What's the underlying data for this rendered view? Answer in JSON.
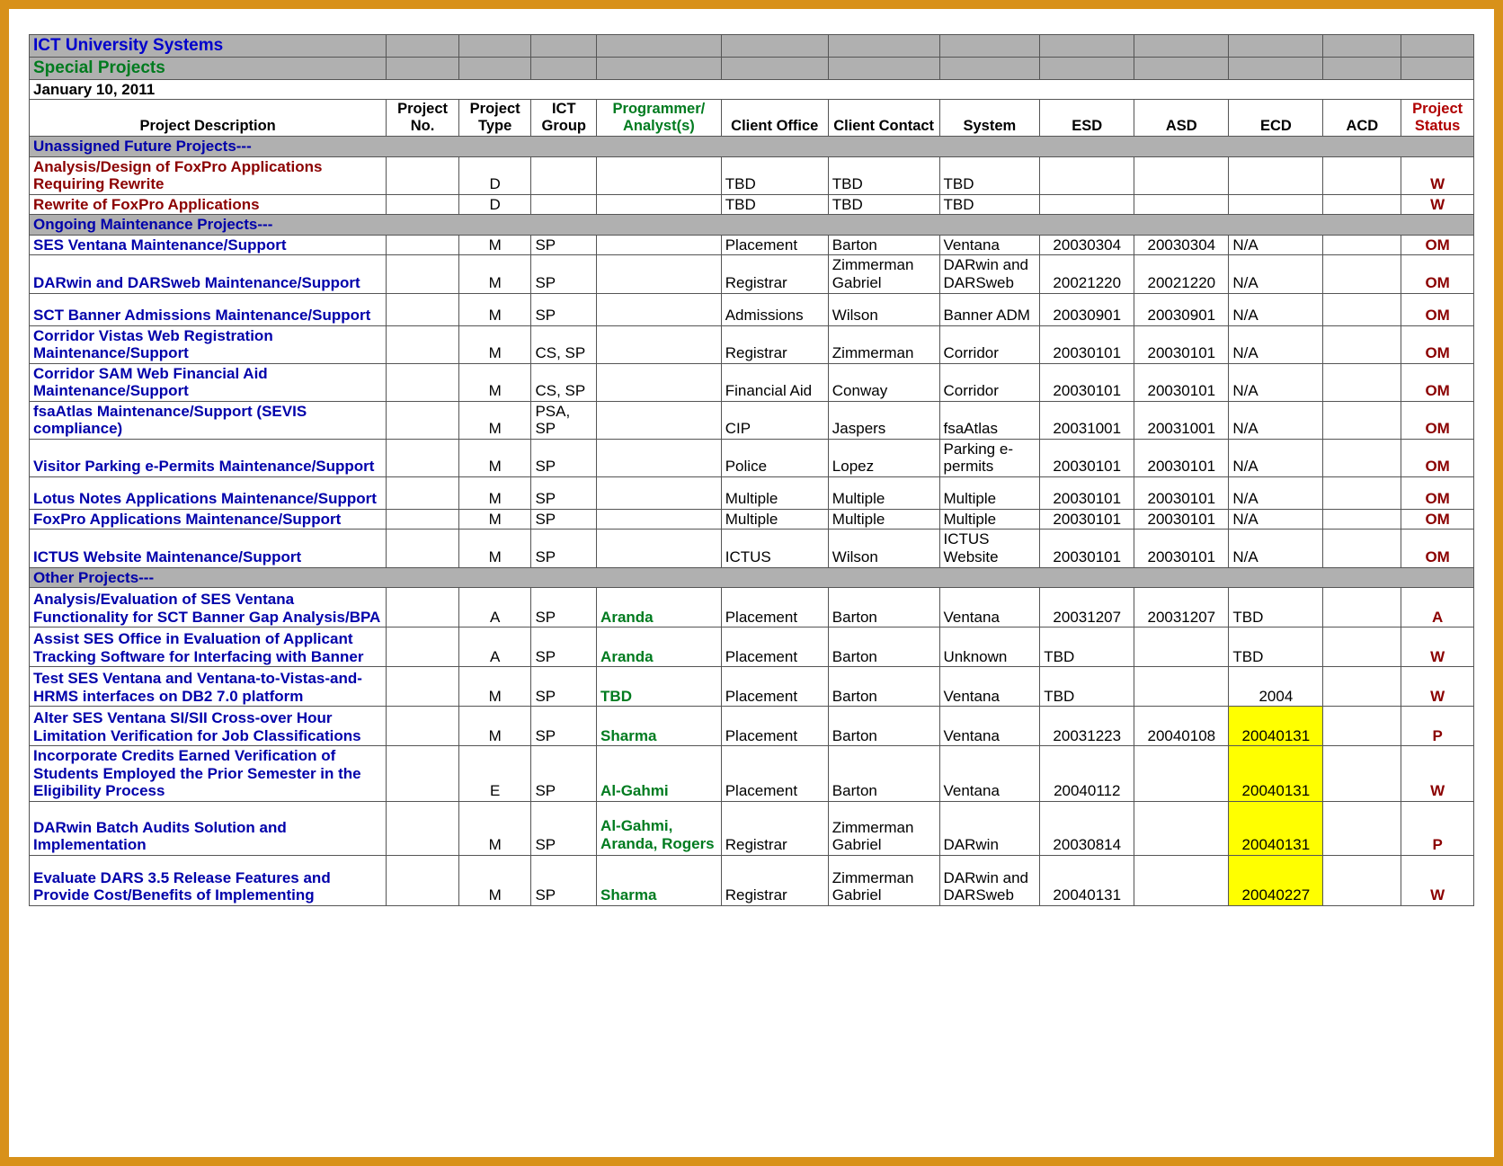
{
  "header": {
    "org": "ICT University Systems",
    "subtitle": "Special Projects",
    "date": "January 10, 2011"
  },
  "columns": {
    "desc": "Project Description",
    "no": "Project No.",
    "type": "Project Type",
    "group": "ICT Group",
    "prog": "Programmer/ Analyst(s)",
    "office": "Client Office",
    "contact": "Client Contact",
    "system": "System",
    "esd": "ESD",
    "asd": "ASD",
    "ecd": "ECD",
    "acd": "ACD",
    "status": "Project Status"
  },
  "sections": {
    "s1": "Unassigned Future Projects---",
    "s2": "Ongoing Maintenance Projects---",
    "s3": "Other Projects---"
  },
  "rows": {
    "r1": {
      "desc": "Analysis/Design of FoxPro Applications Requiring Rewrite",
      "type": "D",
      "office": "TBD",
      "contact": "TBD",
      "system": "TBD",
      "status": "W"
    },
    "r2": {
      "desc": "Rewrite of FoxPro Applications",
      "type": "D",
      "office": "TBD",
      "contact": "TBD",
      "system": "TBD",
      "status": "W"
    },
    "r3": {
      "desc": "SES Ventana Maintenance/Support",
      "type": "M",
      "group": "SP",
      "office": "Placement",
      "contact": "Barton",
      "system": "Ventana",
      "esd": "20030304",
      "asd": "20030304",
      "ecd": "N/A",
      "status": "OM"
    },
    "r4": {
      "desc": "DARwin and DARSweb Maintenance/Support",
      "type": "M",
      "group": "SP",
      "office": "Registrar",
      "contact": "Zimmerman Gabriel",
      "system": "DARwin and DARSweb",
      "esd": "20021220",
      "asd": "20021220",
      "ecd": "N/A",
      "status": "OM"
    },
    "r5": {
      "desc": "SCT Banner Admissions Maintenance/Support",
      "type": "M",
      "group": "SP",
      "office": "Admissions",
      "contact": "Wilson",
      "system": "Banner ADM",
      "esd": "20030901",
      "asd": "20030901",
      "ecd": "N/A",
      "status": "OM"
    },
    "r6": {
      "desc": "Corridor Vistas Web Registration Maintenance/Support",
      "type": "M",
      "group": "CS, SP",
      "office": "Registrar",
      "contact": "Zimmerman",
      "system": "Corridor",
      "esd": "20030101",
      "asd": "20030101",
      "ecd": "N/A",
      "status": "OM"
    },
    "r7": {
      "desc": "Corridor SAM Web Financial Aid Maintenance/Support",
      "type": "M",
      "group": "CS, SP",
      "office": "Financial Aid",
      "contact": "Conway",
      "system": "Corridor",
      "esd": "20030101",
      "asd": "20030101",
      "ecd": "N/A",
      "status": "OM"
    },
    "r8": {
      "desc": "fsaAtlas Maintenance/Support (SEVIS compliance)",
      "type": "M",
      "group": "PSA, SP",
      "office": "CIP",
      "contact": "Jaspers",
      "system": "fsaAtlas",
      "esd": "20031001",
      "asd": "20031001",
      "ecd": "N/A",
      "status": "OM"
    },
    "r9": {
      "desc": "Visitor Parking e-Permits Maintenance/Support",
      "type": "M",
      "group": "SP",
      "office": "Police",
      "contact": "Lopez",
      "system": "Parking e-permits",
      "esd": "20030101",
      "asd": "20030101",
      "ecd": "N/A",
      "status": "OM"
    },
    "r10": {
      "desc": "Lotus Notes Applications Maintenance/Support",
      "type": "M",
      "group": "SP",
      "office": "Multiple",
      "contact": "Multiple",
      "system": "Multiple",
      "esd": "20030101",
      "asd": "20030101",
      "ecd": "N/A",
      "status": "OM"
    },
    "r11": {
      "desc": "FoxPro Applications Maintenance/Support",
      "type": "M",
      "group": "SP",
      "office": "Multiple",
      "contact": "Multiple",
      "system": "Multiple",
      "esd": "20030101",
      "asd": "20030101",
      "ecd": "N/A",
      "status": "OM"
    },
    "r12": {
      "desc": "ICTUS Website Maintenance/Support",
      "type": "M",
      "group": "SP",
      "office": "ICTUS",
      "contact": "Wilson",
      "system": "ICTUS Website",
      "esd": "20030101",
      "asd": "20030101",
      "ecd": "N/A",
      "status": "OM"
    },
    "r13": {
      "desc": "Analysis/Evaluation of SES Ventana Functionality for SCT Banner Gap Analysis/BPA",
      "type": "A",
      "group": "SP",
      "prog": "Aranda",
      "office": "Placement",
      "contact": "Barton",
      "system": "Ventana",
      "esd": "20031207",
      "asd": "20031207",
      "ecd": "TBD",
      "status": "A"
    },
    "r14": {
      "desc": "Assist SES Office in Evaluation of Applicant Tracking Software for Interfacing with Banner",
      "type": "A",
      "group": "SP",
      "prog": "Aranda",
      "office": "Placement",
      "contact": "Barton",
      "system": "Unknown",
      "esd": "TBD",
      "ecd": "TBD",
      "status": "W"
    },
    "r15": {
      "desc": "Test SES Ventana and Ventana-to-Vistas-and-HRMS interfaces on DB2 7.0 platform",
      "type": "M",
      "group": "SP",
      "prog": "TBD",
      "office": "Placement",
      "contact": "Barton",
      "system": "Ventana",
      "esd": "TBD",
      "ecd": "2004",
      "status": "W"
    },
    "r16": {
      "desc": "Alter SES Ventana SI/SII Cross-over Hour Limitation Verification for Job Classifications",
      "type": "M",
      "group": "SP",
      "prog": "Sharma",
      "office": "Placement",
      "contact": "Barton",
      "system": "Ventana",
      "esd": "20031223",
      "asd": "20040108",
      "ecd": "20040131",
      "status": "P"
    },
    "r17": {
      "desc": "Incorporate Credits Earned Verification of Students Employed the Prior Semester in the Eligibility Process",
      "type": "E",
      "group": "SP",
      "prog": "Al-Gahmi",
      "office": "Placement",
      "contact": "Barton",
      "system": "Ventana",
      "esd": "20040112",
      "ecd": "20040131",
      "status": "W"
    },
    "r18": {
      "desc": "DARwin Batch Audits Solution and Implementation",
      "type": "M",
      "group": "SP",
      "prog": "Al-Gahmi, Aranda, Rogers",
      "office": "Registrar",
      "contact": "Zimmerman Gabriel",
      "system": "DARwin",
      "esd": "20030814",
      "ecd": "20040131",
      "status": "P"
    },
    "r19": {
      "desc": "Evaluate DARS 3.5 Release Features and Provide Cost/Benefits of Implementing",
      "type": "M",
      "group": "SP",
      "prog": "Sharma",
      "office": "Registrar",
      "contact": "Zimmerman Gabriel",
      "system": "DARwin and DARSweb",
      "esd": "20040131",
      "ecd": "20040227",
      "status": "W"
    }
  }
}
